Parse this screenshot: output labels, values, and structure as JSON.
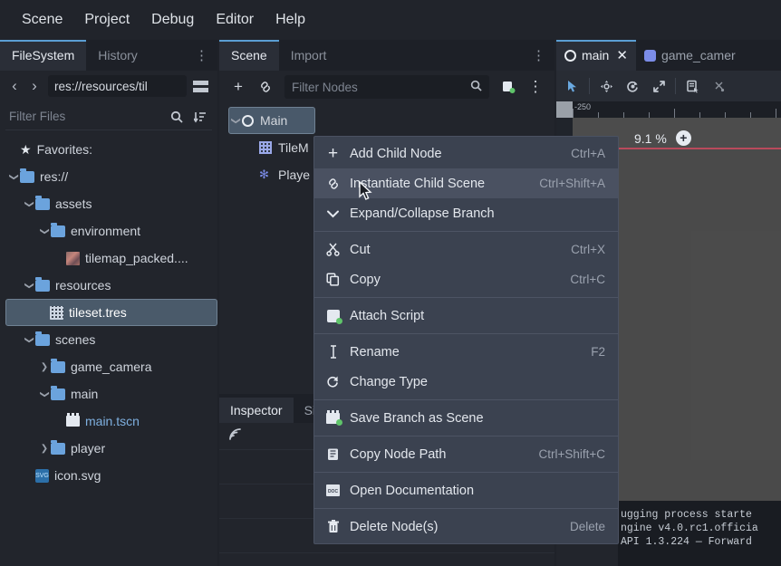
{
  "menubar": {
    "items": [
      {
        "label": "Scene"
      },
      {
        "label": "Project"
      },
      {
        "label": "Debug"
      },
      {
        "label": "Editor"
      },
      {
        "label": "Help"
      }
    ]
  },
  "filesystem_dock": {
    "tabs": [
      {
        "label": "FileSystem",
        "active": true
      },
      {
        "label": "History",
        "active": false
      }
    ],
    "menu_icon": "vertical-dots-icon",
    "nav": {
      "back_icon": "chevron-left-icon",
      "forward_icon": "chevron-right-icon",
      "path": "res://resources/til",
      "layout_icon": "split-mode-icon"
    },
    "filter": {
      "placeholder": "Filter Files",
      "search_icon": "search-icon",
      "sort_icon": "sort-icon"
    },
    "tree": [
      {
        "label": "Favorites:",
        "depth": 0,
        "icon": "star-icon",
        "arrow": "none"
      },
      {
        "label": "res://",
        "depth": 0,
        "icon": "folder-icon",
        "arrow": "down"
      },
      {
        "label": "assets",
        "depth": 1,
        "icon": "folder-icon",
        "arrow": "down"
      },
      {
        "label": "environment",
        "depth": 2,
        "icon": "folder-icon",
        "arrow": "down"
      },
      {
        "label": "tilemap_packed....",
        "depth": 3,
        "icon": "image-thumb-icon",
        "arrow": "none"
      },
      {
        "label": "resources",
        "depth": 1,
        "icon": "folder-icon",
        "arrow": "down"
      },
      {
        "label": "tileset.tres",
        "depth": 2,
        "icon": "tileset-icon",
        "arrow": "none",
        "selected": true
      },
      {
        "label": "scenes",
        "depth": 1,
        "icon": "folder-icon",
        "arrow": "down"
      },
      {
        "label": "game_camera",
        "depth": 2,
        "icon": "folder-icon",
        "arrow": "right"
      },
      {
        "label": "main",
        "depth": 2,
        "icon": "folder-icon",
        "arrow": "down"
      },
      {
        "label": "main.tscn",
        "depth": 3,
        "icon": "scene-icon",
        "arrow": "none",
        "blue": true
      },
      {
        "label": "player",
        "depth": 2,
        "icon": "folder-icon",
        "arrow": "right"
      },
      {
        "label": "icon.svg",
        "depth": 1,
        "icon": "svg-icon",
        "arrow": "none"
      }
    ]
  },
  "scene_dock": {
    "tabs": [
      {
        "label": "Scene",
        "active": true
      },
      {
        "label": "Import",
        "active": false
      }
    ],
    "menu_icon": "vertical-dots-icon",
    "toolbar": {
      "add_icon": "plus-icon",
      "link_icon": "link-icon",
      "filter_placeholder": "Filter Nodes",
      "search_icon": "search-icon",
      "script_icon": "attach-script-icon",
      "more_icon": "vertical-dots-icon"
    },
    "tree": [
      {
        "label": "Main",
        "depth": 0,
        "icon": "node2d-icon",
        "selected": true
      },
      {
        "label": "TileM",
        "depth": 1,
        "icon": "tilemap-icon",
        "selected": false
      },
      {
        "label": "Playe",
        "depth": 1,
        "icon": "player-node-icon",
        "selected": false
      }
    ]
  },
  "inspector_dock": {
    "tabs": [
      {
        "label": "Inspector",
        "active": true
      },
      {
        "label": "Sign",
        "active": false
      }
    ],
    "signal_icon": "signal-icon"
  },
  "viewport": {
    "tabs": [
      {
        "label": "main",
        "active": true,
        "icon": "node2d-icon",
        "close_icon": "close-icon"
      },
      {
        "label": "game_camer",
        "active": false,
        "icon": "packed-scene-icon"
      }
    ],
    "tools": [
      {
        "name": "select-tool",
        "glyph": "➤",
        "active": true
      },
      {
        "name": "move-tool",
        "glyph": "✥",
        "active": false
      },
      {
        "name": "rotate-tool",
        "glyph": "↺",
        "active": false
      },
      {
        "name": "scale-tool",
        "glyph": "⤡",
        "active": false
      },
      {
        "name": "list-select-tool",
        "glyph": "☰",
        "active": false
      },
      {
        "name": "snap-tool",
        "glyph": "✳",
        "active": false
      }
    ],
    "ruler_label": "-250",
    "zoom_level": "9.1 %",
    "zoom_in_icon": "plus-circle-icon"
  },
  "output_panel": {
    "lines": [
      "ugging process starte",
      "ngine v4.0.rc1.officia",
      "API 1.3.224 — Forward"
    ]
  },
  "context_menu": {
    "items": [
      {
        "type": "item",
        "label": "Add Child Node",
        "shortcut": "Ctrl+A",
        "icon": "plus-icon",
        "highlight": false
      },
      {
        "type": "item",
        "label": "Instantiate Child Scene",
        "shortcut": "Ctrl+Shift+A",
        "icon": "link-icon",
        "highlight": true
      },
      {
        "type": "item",
        "label": "Expand/Collapse Branch",
        "shortcut": "",
        "icon": "chevron-down-icon",
        "highlight": false
      },
      {
        "type": "separator"
      },
      {
        "type": "item",
        "label": "Cut",
        "shortcut": "Ctrl+X",
        "icon": "scissors-icon",
        "highlight": false
      },
      {
        "type": "item",
        "label": "Copy",
        "shortcut": "Ctrl+C",
        "icon": "copy-icon",
        "highlight": false
      },
      {
        "type": "separator"
      },
      {
        "type": "item",
        "label": "Attach Script",
        "shortcut": "",
        "icon": "attach-script-icon",
        "highlight": false
      },
      {
        "type": "separator"
      },
      {
        "type": "item",
        "label": "Rename",
        "shortcut": "F2",
        "icon": "text-cursor-icon",
        "highlight": false
      },
      {
        "type": "item",
        "label": "Change Type",
        "shortcut": "",
        "icon": "refresh-icon",
        "highlight": false
      },
      {
        "type": "separator"
      },
      {
        "type": "item",
        "label": "Save Branch as Scene",
        "shortcut": "",
        "icon": "save-scene-icon",
        "highlight": false
      },
      {
        "type": "separator"
      },
      {
        "type": "item",
        "label": "Copy Node Path",
        "shortcut": "Ctrl+Shift+C",
        "icon": "copy-path-icon",
        "highlight": false
      },
      {
        "type": "separator"
      },
      {
        "type": "item",
        "label": "Open Documentation",
        "shortcut": "",
        "icon": "documentation-icon",
        "highlight": false
      },
      {
        "type": "separator"
      },
      {
        "type": "item",
        "label": "Delete Node(s)",
        "shortcut": "Delete",
        "icon": "trash-icon",
        "highlight": false
      }
    ]
  },
  "colors": {
    "accent": "#5b9fd4",
    "menu_bg": "#3b4250",
    "panel_bg": "#22252c",
    "canvas": "#4c4c4c",
    "guide_red": "#b94a5c"
  }
}
